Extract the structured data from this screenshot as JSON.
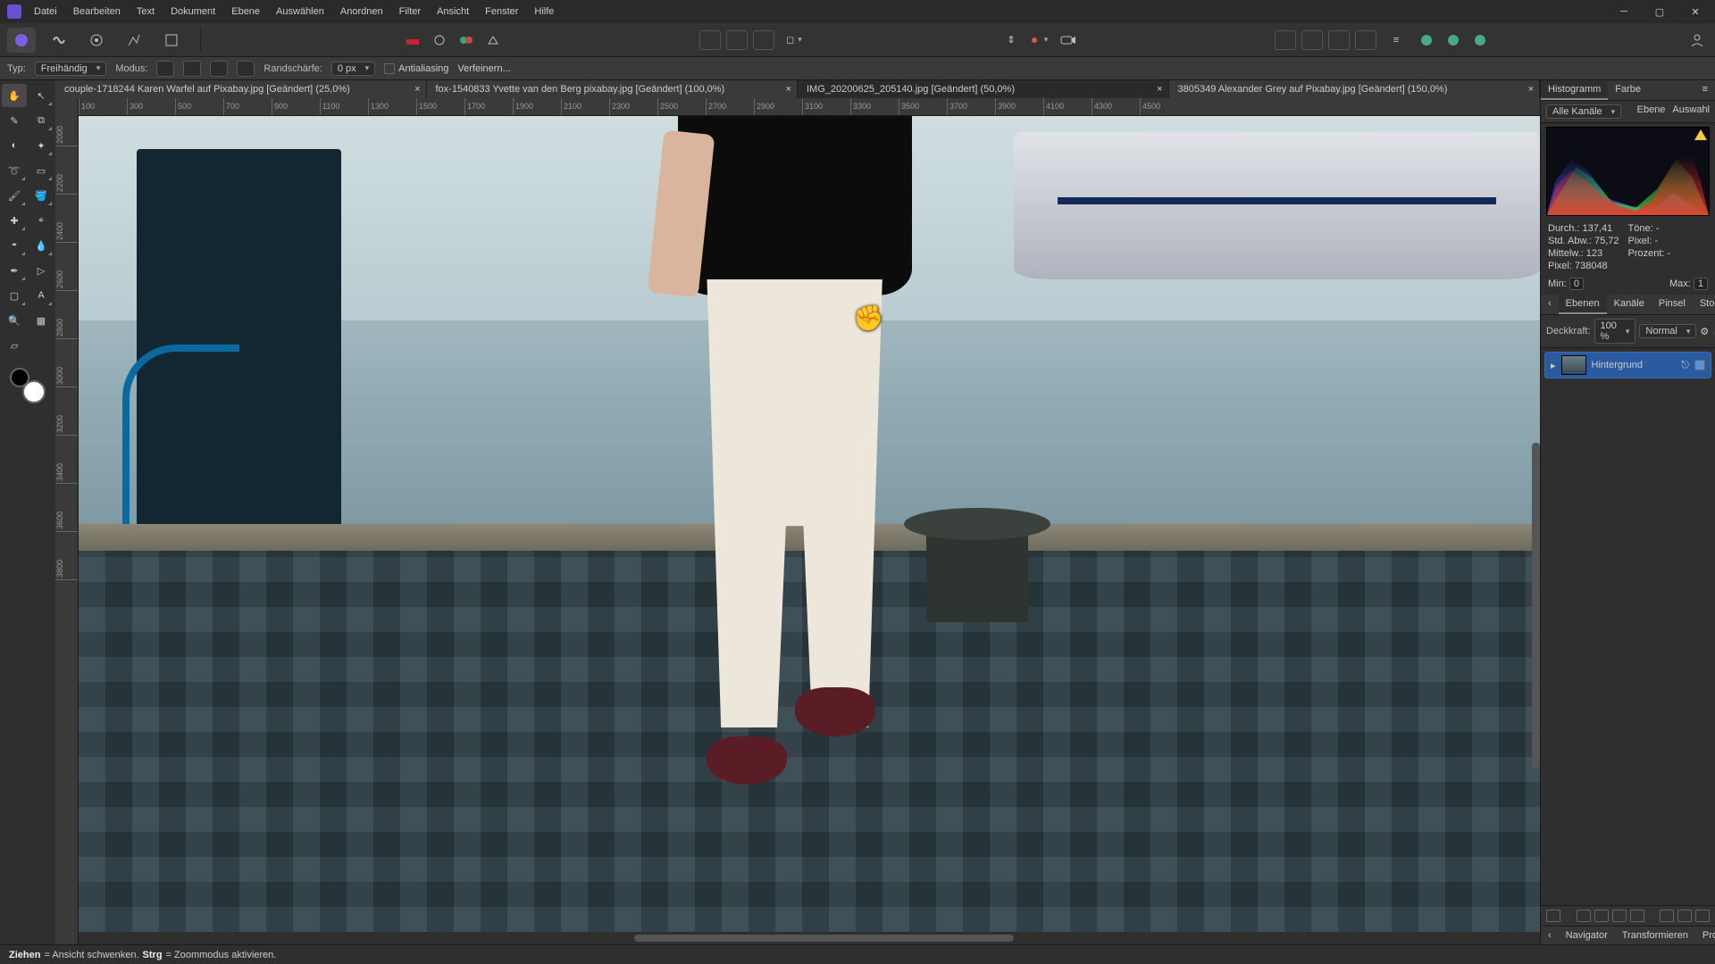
{
  "menu": [
    "Datei",
    "Bearbeiten",
    "Text",
    "Dokument",
    "Ebene",
    "Auswählen",
    "Anordnen",
    "Filter",
    "Ansicht",
    "Fenster",
    "Hilfe"
  ],
  "context": {
    "typeLabel": "Typ:",
    "typeValue": "Freihändig",
    "modeLabel": "Modus:",
    "featherLabel": "Randschärfe:",
    "featherValue": "0 px",
    "antialias": "Antialiasing",
    "refine": "Verfeinern..."
  },
  "tabs": [
    {
      "title": "couple-1718244 Karen Warfel auf Pixabay.jpg [Geändert] (25,0%)"
    },
    {
      "title": "fox-1540833 Yvette van den Berg pixabay.jpg [Geändert] (100,0%)"
    },
    {
      "title": "IMG_20200625_205140.jpg [Geändert] (50,0%)"
    },
    {
      "title": "3805349 Alexander Grey auf Pixabay.jpg [Geändert] (150,0%)"
    }
  ],
  "activeTab": 2,
  "rulerH": [
    "100",
    "300",
    "500",
    "700",
    "900",
    "1100",
    "1300",
    "1500",
    "1700",
    "1900",
    "2100",
    "2300",
    "2500",
    "2700",
    "2900",
    "3100",
    "3300",
    "3500",
    "3700",
    "3900",
    "4100",
    "4300",
    "4500"
  ],
  "rulerV": [
    "2000",
    "2200",
    "2400",
    "2600",
    "2800",
    "3000",
    "3200",
    "3400",
    "3600",
    "3800"
  ],
  "panels": {
    "histTabs": [
      "Histogramm",
      "Farbe"
    ],
    "channelsLabel": "Alle Kanäle",
    "channelsBtns": [
      "Ebene",
      "Auswahl"
    ],
    "stats": {
      "durchL": "Durch.:",
      "durchV": "137,41",
      "stdL": "Std. Abw.:",
      "stdV": "75,72",
      "mittelL": "Mittelw.:",
      "mittelV": "123",
      "pixelL": "Pixel:",
      "pixelV": "738048",
      "toneL": "Töne:",
      "toneV": "-",
      "pxL": "Pixel:",
      "pxV": "-",
      "pctL": "Prozent:",
      "pctV": "-"
    },
    "minL": "Min:",
    "minV": "0",
    "maxL": "Max:",
    "maxV": "1",
    "layerTabs": [
      "Ebenen",
      "Kanäle",
      "Pinsel",
      "Stock"
    ],
    "opacityL": "Deckkraft:",
    "opacityV": "100 %",
    "blend": "Normal",
    "layerName": "Hintergrund",
    "bottomTabs": [
      "Navigator",
      "Transformieren",
      "Protokoll"
    ]
  },
  "status": {
    "drag": "Ziehen",
    "dragTxt": " = Ansicht schwenken. ",
    "ctrl": "Strg",
    "ctrlTxt": " = Zoommodus aktivieren."
  }
}
